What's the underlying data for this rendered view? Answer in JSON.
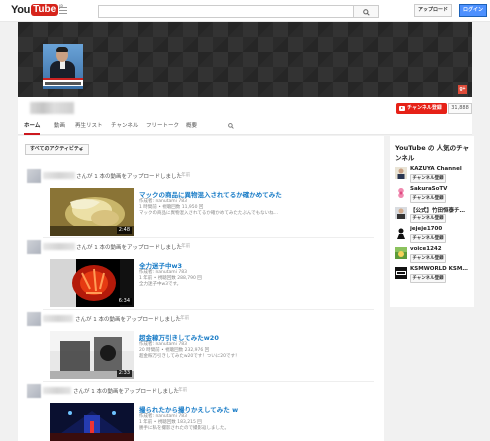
{
  "masthead": {
    "logo_you": "You",
    "logo_tube": "Tube",
    "logo_region": "JP",
    "search_placeholder": "",
    "upload_label": "アップロード",
    "login_label": "ログイン"
  },
  "channel": {
    "subscribe_label": "チャンネル登録",
    "subscriber_count": "31,888",
    "tabs": [
      "ホーム",
      "動画",
      "再生リスト",
      "チャンネル",
      "フリートーク",
      "概要"
    ]
  },
  "feed": {
    "filter_label": "すべてのアクティビティ",
    "items": [
      {
        "action": "さんが 1 本の動画をアップロードしました",
        "time": "1 年前",
        "title": "マックの商品に異物混入されてるか確かめてみた",
        "author": "作成者: nanutami 783",
        "views": "1 時間前 • 視聴回数 11,950 回",
        "desc": "マックの商品に異物混入されてるか確かめてみたたぶんでもないね…",
        "duration": "2:48"
      },
      {
        "action": "さんが 1 本の動画をアップロードしました",
        "time": "1 年前",
        "title": "全力迷子中w3",
        "author": "作成者: nanutami 783",
        "views": "1 年前 • 視聴回数 288,790 回",
        "desc": "全力迷子中w3です。",
        "duration": "6:34"
      },
      {
        "action": "さんが 1 本の動画をアップロードしました",
        "time": "1 年前",
        "title": "超金稼万引きしてみたw20",
        "author": "作成者: nanutami 783",
        "views": "20 時間前 • 視聴回数 232,976 回",
        "desc": "超金稼万引きしてみたw20です！ついに20です！",
        "duration": "2:33"
      },
      {
        "action": "さんが 1 本の動画をアップロードしました",
        "time": "1 年前",
        "title": "撮られたから撮りかえしてみた w",
        "author": "作成者: nanutami 783",
        "views": "1 年前 • 視聴回数 183,215 回",
        "desc": "勝手に私を撮影されたので撮影返しました。",
        "duration": ""
      }
    ]
  },
  "sidebar": {
    "title": "YouTube の 人気のチャンネル",
    "button_label": "チャンネル登録",
    "channels": [
      {
        "name": "KAZUYA Channel",
        "check": "✔"
      },
      {
        "name": "SakuraSoTV",
        "check": ""
      },
      {
        "name": "【公式】竹田恒泰チ…",
        "check": ""
      },
      {
        "name": "jejeje1700",
        "check": ""
      },
      {
        "name": "voice1242",
        "check": ""
      },
      {
        "name": "KSMWORLD KSM…",
        "check": ""
      }
    ]
  }
}
